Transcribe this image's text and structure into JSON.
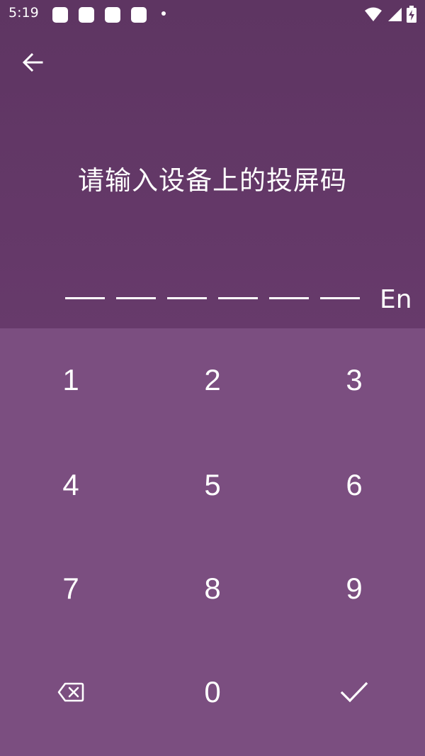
{
  "status_bar": {
    "time": "5:19",
    "icons": [
      "notification-icon",
      "notification-icon",
      "notification-icon",
      "notification-icon",
      "wifi-icon",
      "signal-icon",
      "battery-charging-icon"
    ]
  },
  "header": {
    "back_icon": "arrow-left-icon",
    "title": "请输入设备上的投屏码"
  },
  "code_input": {
    "slots": [
      "",
      "",
      "",
      "",
      "",
      ""
    ],
    "language_toggle": "En"
  },
  "keypad": {
    "keys": [
      "1",
      "2",
      "3",
      "4",
      "5",
      "6",
      "7",
      "8",
      "9"
    ],
    "zero": "0",
    "backspace_icon": "backspace-icon",
    "confirm_icon": "check-icon"
  },
  "colors": {
    "header_bg": "#5e3562",
    "keypad_bg": "#7b4e80",
    "text": "#ffffff"
  }
}
